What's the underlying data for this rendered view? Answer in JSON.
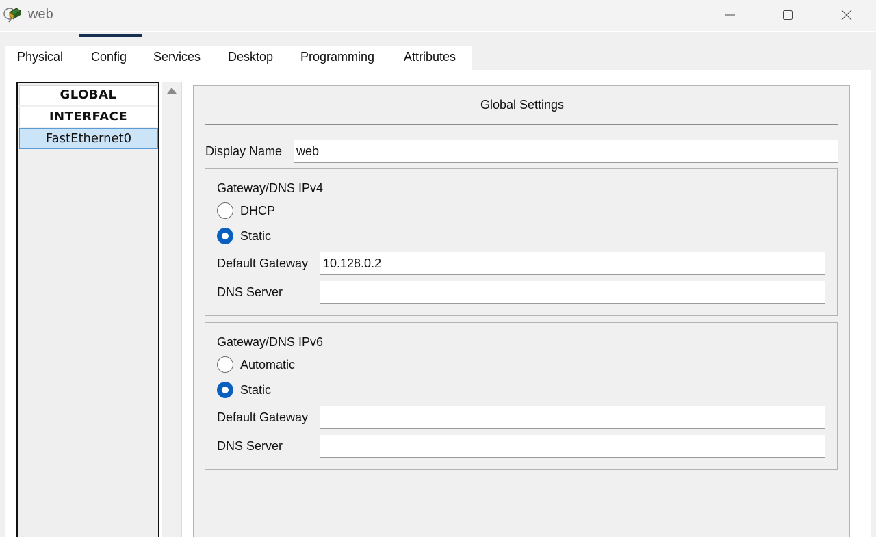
{
  "window": {
    "title": "web",
    "app_icon": "packet-tracer-device-icon",
    "controls": {
      "minimize": "minimize-icon",
      "maximize": "maximize-icon",
      "close": "close-icon"
    }
  },
  "tabs": [
    {
      "label": "Physical"
    },
    {
      "label": "Config",
      "active": true
    },
    {
      "label": "Services"
    },
    {
      "label": "Desktop"
    },
    {
      "label": "Programming"
    },
    {
      "label": "Attributes"
    }
  ],
  "left_panel": {
    "headers": [
      "GLOBAL",
      "INTERFACE"
    ],
    "items": [
      {
        "label": "FastEthernet0",
        "selected": true
      }
    ]
  },
  "global_settings": {
    "title": "Global Settings",
    "display_name_label": "Display Name",
    "display_name_value": "web",
    "ipv4": {
      "title": "Gateway/DNS IPv4",
      "options": [
        {
          "label": "DHCP",
          "checked": false
        },
        {
          "label": "Static",
          "checked": true
        }
      ],
      "gateway_label": "Default Gateway",
      "gateway_value": "10.128.0.2",
      "dns_label": "DNS Server",
      "dns_value": ""
    },
    "ipv6": {
      "title": "Gateway/DNS IPv6",
      "options": [
        {
          "label": "Automatic",
          "checked": false
        },
        {
          "label": "Static",
          "checked": true
        }
      ],
      "gateway_label": "Default Gateway",
      "gateway_value": "",
      "dns_label": "DNS Server",
      "dns_value": ""
    }
  },
  "colors": {
    "accent": "#0a5fbf",
    "tab_underline": "#18304f",
    "selected_item": "#cce4f7"
  }
}
